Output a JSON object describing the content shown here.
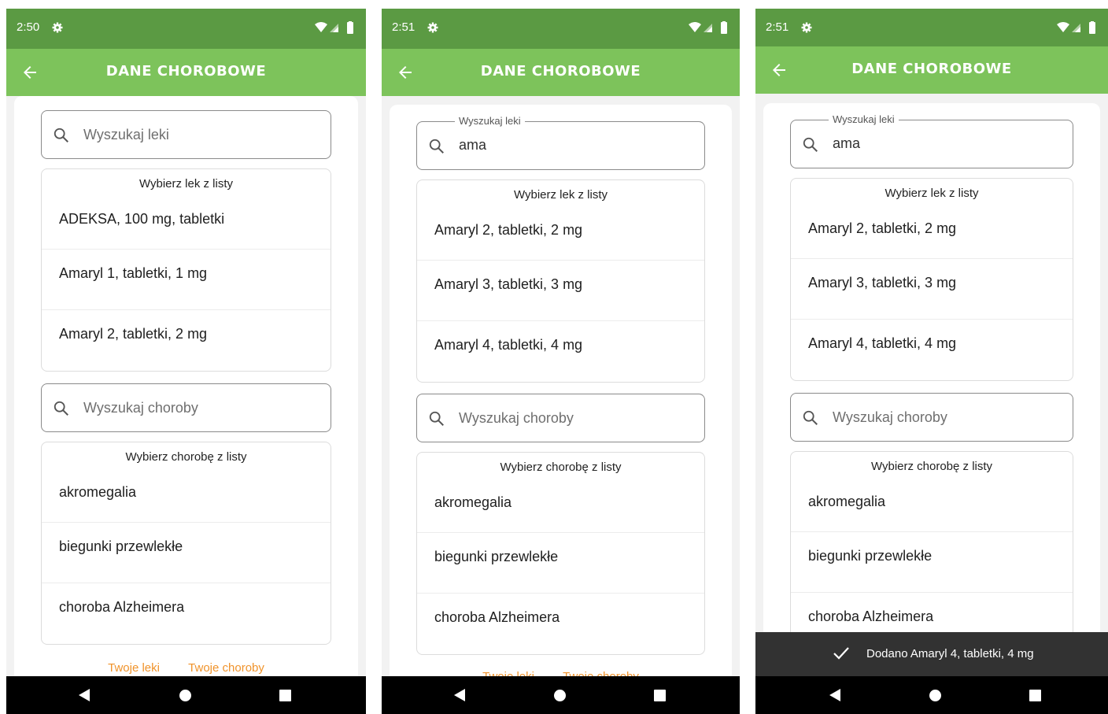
{
  "app_title": "DANE CHOROBOWE",
  "drug_list_title": "Wybierz lek z listy",
  "disease_list_title": "Wybierz chorobę z listy",
  "drug_search_label": "Wyszukaj leki",
  "drug_search_placeholder": "Wyszukaj leki",
  "disease_search_placeholder": "Wyszukaj choroby",
  "footer": {
    "my_drugs": "Twoje leki",
    "my_diseases": "Twoje choroby"
  },
  "colors": {
    "status_bar": "#5b9a43",
    "app_bar": "#7dc35b",
    "link": "#f0932b"
  },
  "icons": [
    "settings-icon",
    "wifi-icon",
    "signal-icon",
    "battery-icon",
    "back-arrow-icon",
    "search-icon",
    "checkmark-icon"
  ],
  "screens": [
    {
      "time": "2:50",
      "drug_query": "",
      "drugs": [
        "ADEKSA, 100 mg, tabletki",
        "Amaryl 1, tabletki, 1 mg",
        "Amaryl 2, tabletki, 2 mg"
      ],
      "diseases": [
        "akromegalia",
        "biegunki przewlekłe",
        "choroba Alzheimera"
      ]
    },
    {
      "time": "2:51",
      "drug_query": "ama",
      "drugs": [
        "Amaryl 2, tabletki, 2 mg",
        "Amaryl 3, tabletki, 3 mg",
        "Amaryl 4, tabletki, 4 mg"
      ],
      "diseases": [
        "akromegalia",
        "biegunki przewlekłe",
        "choroba Alzheimera"
      ]
    },
    {
      "time": "2:51",
      "drug_query": "ama",
      "drugs": [
        "Amaryl 2, tabletki, 2 mg",
        "Amaryl 3, tabletki, 3 mg",
        "Amaryl 4, tabletki, 4 mg"
      ],
      "diseases": [
        "akromegalia",
        "biegunki przewlekłe",
        "choroba Alzheimera"
      ],
      "snackbar": "Dodano Amaryl 4, tabletki, 4 mg"
    }
  ]
}
